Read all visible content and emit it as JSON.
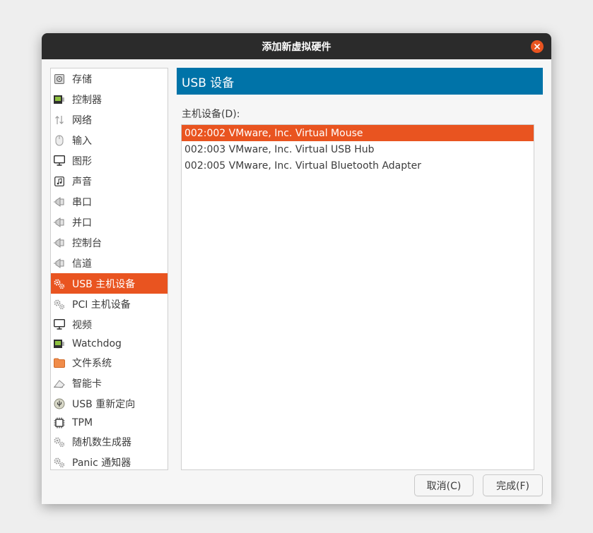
{
  "window": {
    "title": "添加新虚拟硬件"
  },
  "sidebar": {
    "items": [
      {
        "label": "存储",
        "icon": "disk-icon"
      },
      {
        "label": "控制器",
        "icon": "controller-card-icon"
      },
      {
        "label": "网络",
        "icon": "network-icon"
      },
      {
        "label": "输入",
        "icon": "mouse-icon"
      },
      {
        "label": "图形",
        "icon": "monitor-icon"
      },
      {
        "label": "声音",
        "icon": "music-icon"
      },
      {
        "label": "串口",
        "icon": "serial-port-icon"
      },
      {
        "label": "并口",
        "icon": "parallel-port-icon"
      },
      {
        "label": "控制台",
        "icon": "console-icon"
      },
      {
        "label": "信道",
        "icon": "channel-icon"
      },
      {
        "label": "USB 主机设备",
        "icon": "usb-device-icon",
        "selected": true
      },
      {
        "label": "PCI 主机设备",
        "icon": "pci-device-icon"
      },
      {
        "label": "视频",
        "icon": "video-icon"
      },
      {
        "label": "Watchdog",
        "icon": "watchdog-card-icon"
      },
      {
        "label": "文件系统",
        "icon": "folder-icon"
      },
      {
        "label": "智能卡",
        "icon": "smartcard-icon"
      },
      {
        "label": "USB 重新定向",
        "icon": "usb-redirect-icon"
      },
      {
        "label": "TPM",
        "icon": "chip-icon"
      },
      {
        "label": "随机数生成器",
        "icon": "rng-icon"
      },
      {
        "label": "Panic 通知器",
        "icon": "panic-notifier-icon"
      }
    ]
  },
  "main": {
    "header": "USB 设备",
    "host_label": "主机设备(D):",
    "devices": [
      {
        "label": "002:002 VMware, Inc. Virtual Mouse",
        "selected": true
      },
      {
        "label": "002:003 VMware, Inc. Virtual USB Hub"
      },
      {
        "label": "002:005 VMware, Inc. Virtual Bluetooth Adapter"
      }
    ]
  },
  "buttons": {
    "cancel": "取消(C)",
    "finish": "完成(F)"
  },
  "colors": {
    "accent": "#e95420",
    "header": "#0073a8",
    "titlebar": "#2b2b2b"
  }
}
